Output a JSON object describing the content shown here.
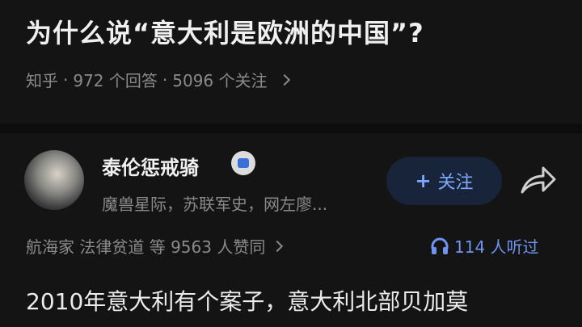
{
  "question": {
    "title": "为什么说“意大利是欧洲的中国”?",
    "source": "知乎",
    "answers": "972 个回答",
    "followers": "5096 个关注",
    "sep": "·"
  },
  "answer": {
    "author_name": "泰伦惩戒骑",
    "author_desc": "魔兽星际，苏联军史，网左廖...",
    "follow_label": "关注",
    "follow_plus": "+",
    "endorsement": "航海家 法律贫道 等 9563 人赞同",
    "listeners": "114 人听过",
    "text": "2010年意大利有个案子，意大利北部贝加莫"
  },
  "colors": {
    "background": "#141414",
    "accent": "#7fa8ff",
    "muted": "#8a8a8a"
  },
  "icons": [
    "chevron-right-icon",
    "verified-badge-icon",
    "share-icon",
    "headphones-icon"
  ]
}
